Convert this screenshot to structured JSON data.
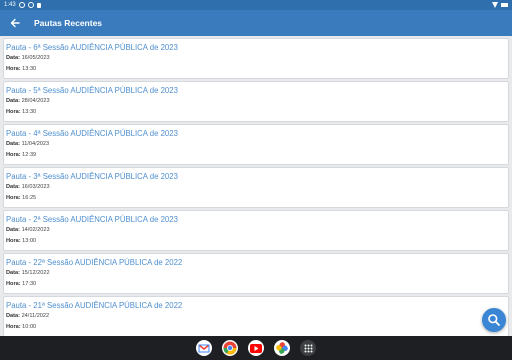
{
  "status_bar": {
    "time": "1:43"
  },
  "appbar": {
    "title": "Pautas Recentes",
    "back_icon": "arrow-left-icon"
  },
  "labels": {
    "date": "Data:",
    "time": "Hora:"
  },
  "items": [
    {
      "title": "Pauta - 6ª Sessão AUDIÊNCIA PÚBLICA de 2023",
      "date": "16/05/2023",
      "time": "13:30"
    },
    {
      "title": "Pauta - 5ª Sessão AUDIÊNCIA PÚBLICA de 2023",
      "date": "28/04/2023",
      "time": "13:30"
    },
    {
      "title": "Pauta - 4ª Sessão AUDIÊNCIA PÚBLICA de 2023",
      "date": "11/04/2023",
      "time": "12:39"
    },
    {
      "title": "Pauta - 3ª Sessão AUDIÊNCIA PÚBLICA de 2023",
      "date": "16/03/2023",
      "time": "16:25"
    },
    {
      "title": "Pauta - 2ª Sessão AUDIÊNCIA PÚBLICA de 2023",
      "date": "14/02/2023",
      "time": "13:00"
    },
    {
      "title": "Pauta - 22ª Sessão AUDIÊNCIA PÚBLICA de 2022",
      "date": "15/12/2022",
      "time": "17:30"
    },
    {
      "title": "Pauta - 21ª Sessão AUDIÊNCIA PÚBLICA de 2022",
      "date": "24/11/2022",
      "time": "10:00"
    }
  ],
  "fab": {
    "icon": "search-icon"
  },
  "dock": {
    "apps": [
      "gmail-icon",
      "chrome-icon",
      "youtube-icon",
      "photos-icon",
      "app-drawer-icon"
    ]
  },
  "colors": {
    "appbar": "#3a7bbd",
    "accent": "#4e8fcf",
    "fab": "#3a86d4"
  }
}
